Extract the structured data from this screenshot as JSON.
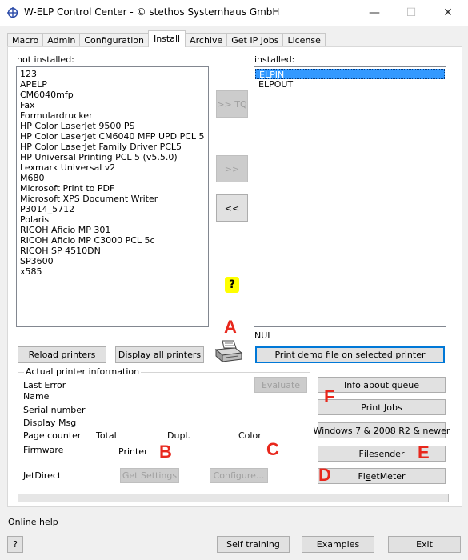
{
  "window": {
    "title": "W-ELP Control Center - © stethos Systemhaus GmbH",
    "minimize_glyph": "—",
    "maximize_glyph": "☐",
    "close_glyph": "✕",
    "icon": "crosshair-globe-icon"
  },
  "tabs": [
    {
      "label": "Macro"
    },
    {
      "label": "Admin"
    },
    {
      "label": "Configuration"
    },
    {
      "label": "Install",
      "active": true
    },
    {
      "label": "Archive"
    },
    {
      "label": "Get IP Jobs"
    },
    {
      "label": "License"
    }
  ],
  "install": {
    "not_installed_label": "not installed:",
    "installed_label": "installed:",
    "not_installed": [
      "123",
      "APELP",
      "CM6040mfp",
      "Fax",
      "Formulardrucker",
      "HP Color LaserJet 9500 PS",
      "HP Color LaserJet CM6040 MFP UPD PCL 5",
      "HP Color LaserJet Family Driver PCL5",
      "HP Universal Printing PCL 5 (v5.5.0)",
      "Lexmark Universal v2",
      "M680",
      "Microsoft Print to PDF",
      "Microsoft XPS Document Writer",
      "P3014_5712",
      "Polaris",
      "RICOH Aficio MP 301",
      "RICOH Aficio MP C3000 PCL 5c",
      "RICOH SP 4510DN",
      "SP3600",
      "x585"
    ],
    "installed": [
      {
        "label": "ELPIN",
        "selected": true
      },
      {
        "label": "ELPOUT",
        "selected": false
      }
    ],
    "port_label": "NUL",
    "btn_tq": ">> TQ",
    "btn_add": ">>",
    "btn_remove": "<<",
    "help_glyph": "?",
    "reload_printers": "Reload printers",
    "display_all_printers": "Display all printers",
    "print_demo": "Print demo file on selected printer",
    "printer_icon": "printer-icon"
  },
  "printer_info": {
    "group_title": "Actual printer information",
    "last_error": "Last Error",
    "name": "Name",
    "serial_number": "Serial number",
    "display_msg": "Display Msg",
    "page_counter": "Page counter",
    "total": "Total",
    "dupl": "Dupl.",
    "color": "Color",
    "firmware": "Firmware",
    "printer": "Printer",
    "jetdirect": "JetDirect",
    "evaluate": "Evaluate",
    "get_settings": "Get Settings",
    "configure": "Configure..."
  },
  "right_buttons": {
    "info_about_queue": "Info about queue",
    "print_jobs": "Print Jobs",
    "windows7": "Windows 7 & 2008 R2 & newer",
    "filesender_underlined": "F",
    "filesender_rest": "ilesender",
    "fleetmeter_pre": "Fl",
    "fleetmeter_underlined": "e",
    "fleetmeter_post": "etMeter"
  },
  "markers": {
    "a": "A",
    "b": "B",
    "c": "C",
    "d": "D",
    "e": "E",
    "f": "F"
  },
  "footer": {
    "online_help": "Online help",
    "help": "?",
    "self_training": "Self training",
    "examples": "Examples",
    "exit": "Exit"
  },
  "colors": {
    "selection": "#3399ff",
    "marker": "#e8271c",
    "help_badge": "#ffff00"
  }
}
